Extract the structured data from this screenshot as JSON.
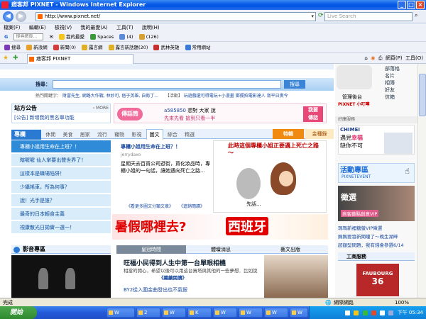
{
  "window": {
    "title": "痞客邦 PIXNET - Windows Internet Explorer",
    "min": "_",
    "max": "□",
    "close": "×"
  },
  "address": {
    "url": "http://www.pixnet.net/",
    "search_placeholder": "Live Search"
  },
  "menu": [
    "檔案(F)",
    "編輯(E)",
    "檢視(V)",
    "我的最愛(A)",
    "工具(T)",
    "說明(H)"
  ],
  "toolbar": {
    "row1": [
      {
        "icon": "google-icon",
        "label": "G"
      },
      {
        "icon": "search-input",
        "label": "搜尋網頁...",
        "input": true
      },
      {
        "icon": "mail-icon",
        "label": "✉"
      },
      {
        "icon": "star-icon",
        "label": "我的最愛"
      },
      {
        "icon": "spaces-icon",
        "label": "Spaces"
      },
      {
        "icon": "msn-icon",
        "label": "(4)"
      },
      {
        "icon": "mail-count-icon",
        "label": "(126)"
      }
    ],
    "row2": [
      {
        "icon": "yahoo-icon",
        "label": "搜尋"
      },
      {
        "icon": "sina-icon",
        "label": "新浪網"
      },
      {
        "icon": "news-icon",
        "label": "新聞(0)"
      },
      {
        "icon": "gift-icon",
        "label": "露言網"
      },
      {
        "icon": "gift-icon",
        "label": "露言新話題(20)"
      },
      {
        "icon": "game-icon",
        "label": "武林英雄"
      },
      {
        "icon": "web-icon",
        "label": "常用網站"
      }
    ]
  },
  "tab": {
    "label": "痞客邦 PIXNET",
    "tools": [
      "網頁(P)",
      "工具(O)"
    ]
  },
  "page": {
    "search_label": "搜尋：",
    "search_button": "搜尋",
    "hot_label": "熱門關鍵字：",
    "hot_keywords": "財富先生, 網路大作戰, 林妙可, 痞子英雄, 自衛丁...",
    "event_label": "【活動】",
    "event_text": "玩遊戲還可得電玩+小漫畫    鄧擺拍電影達人 寫平日奧今",
    "notice_title": "站方公告",
    "notice_more": "› MORE",
    "notice_item": "[公告] 新增我的黑名單功能",
    "pager_label": "傳話筒",
    "pager_user": "a585850",
    "pager_text1": "想對 大家 說",
    "pager_text2": "先來先看 搶到只看一半",
    "pager_btn1": "我要",
    "pager_btn2": "傳話",
    "section_title": "專欄",
    "categories": [
      "休閒",
      "美食",
      "居家",
      "流行",
      "寵物",
      "影視",
      "圖文",
      "綜合",
      "精選"
    ],
    "active_category": "圖文",
    "special_label": "特輯",
    "golden_label": "金種錄",
    "topics": [
      "專櫃小姐用生命在上班？！",
      "瞎喔喔 仙人掌要出聲世界了！",
      "這樣本是職場陷阱！",
      "少攝搖車，所為何事？",
      "說！光手是誰？",
      "最奇的日本輕食主義",
      "視康散光日拋實一選一！"
    ],
    "article_title": "專櫃小姐用生命在上班？！",
    "article_author": "jerrydaxo",
    "article_body": "星期天去百貨公司逛街，買化妝品時，專櫃小姐的一句話，讓她遇向死亡之路...",
    "article_link1": "《看更多圖文分類文章》",
    "article_link2": "《進銷閱讀》",
    "comic_caption": "此時這個專櫃小姐正要邁上死亡之路～",
    "comic_label": "先話...",
    "banner_text": "暑假哪裡去?",
    "banner_highlight": "西班牙",
    "video_title": "影音專區",
    "news_tabs": [
      "皇冠時間",
      "體壇消息",
      "藝文出版"
    ],
    "news_headline": "旺福小民得到人生中第一台單眼相機",
    "news_body": "相當的開心，希望以後可以用這台買塔與其他的一些夢想．比如說",
    "news_more": "《繼續閱讀》",
    "news_item2": "BY2從入圍金曲發出也不氣餒",
    "right_menu": [
      "部落格",
      "名片",
      "相簿",
      "好友",
      "信箱"
    ],
    "admin_label": "管理後台",
    "admin_sub": "PIXNET 小叮嚀",
    "ad_label": "好康服務",
    "chimei_label": "CHIMEI",
    "chimei_text1": "遇見",
    "chimei_highlight": "幸福",
    "chimei_text2": "缺你不可",
    "activity_title": "活動專區",
    "activity_sub": "PIXNETEVENT",
    "vip_text1": "徵選",
    "vip_text2": "痞客藝點創意VIP",
    "vip_item1": "瑪瑪新裡糖螢VIP徵選",
    "vip_item2": "媽媽要發新聞嘍了～晚生湖畔",
    "vip_item3": "超額型問題，我有錢會參選6/14",
    "workshop_title": "工商服務",
    "faubourg": "FAUBOURG",
    "faubourg_num": "36"
  },
  "status": {
    "text": "完成",
    "zone": "網際網路",
    "zoom": "100%"
  },
  "taskbar": {
    "start": "開始",
    "tasks": [
      "W",
      "2",
      "W",
      "K",
      "W",
      "W",
      "W",
      "W"
    ],
    "clock": "下午 05:34"
  },
  "colors": {
    "accent": "#2a7ad4",
    "pixnet_orange": "#ff6600",
    "banner_red": "#e00000"
  }
}
